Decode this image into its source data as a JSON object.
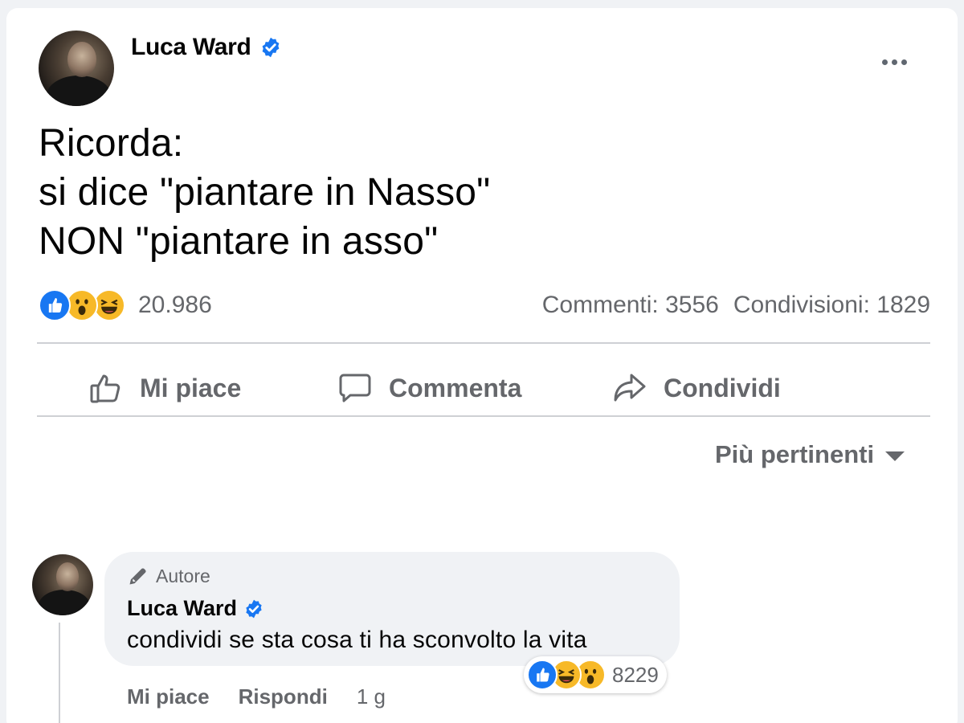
{
  "post": {
    "author": "Luca Ward",
    "text": "Ricorda:\nsi dice \"piantare in Nasso\"\nNON \"piantare in asso\"",
    "reaction_count": "20.986",
    "comments": "Commenti: 3556",
    "shares": "Condivisioni: 1829"
  },
  "actions": {
    "like": "Mi piace",
    "comment": "Commenta",
    "share": "Condividi"
  },
  "sort": {
    "label": "Più pertinenti"
  },
  "comment": {
    "badge": "Autore",
    "author": "Luca Ward",
    "text": "condividi se sta cosa ti ha sconvolto la vita",
    "reaction_count": "8229",
    "like": "Mi piace",
    "reply": "Rispondi",
    "time": "1 g"
  },
  "colors": {
    "brand": "#1877f2",
    "secondary_text": "#65676b",
    "reaction_yellow": "#f7b928"
  },
  "icons": {
    "verified": "verified-badge-icon",
    "more": "more-options-icon",
    "like": "thumbs-up-icon",
    "comment": "speech-bubble-icon",
    "share": "share-arrow-icon",
    "sort": "caret-down-icon",
    "author_badge": "pencil-icon"
  }
}
